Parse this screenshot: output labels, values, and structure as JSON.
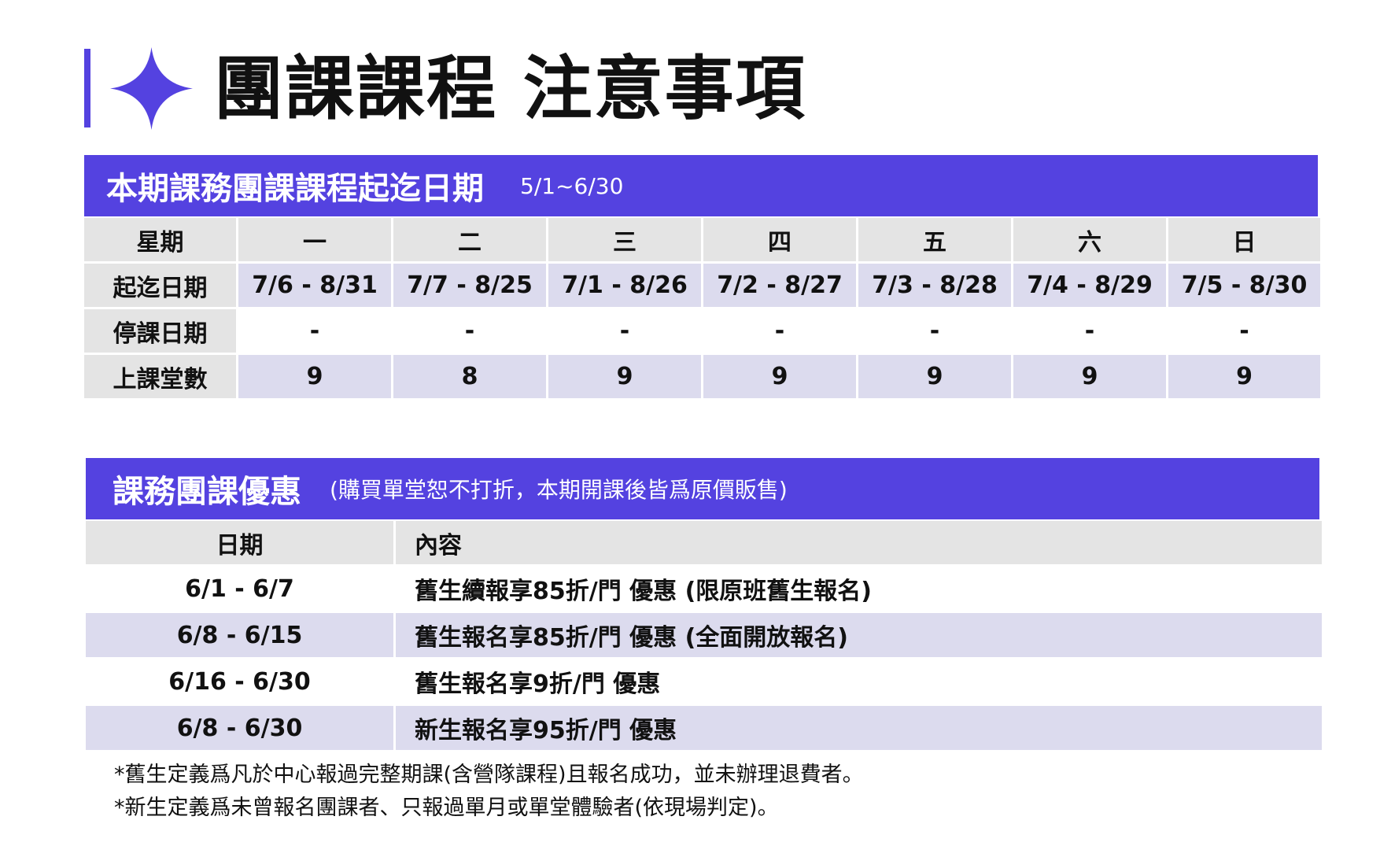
{
  "title": "團課課程 注意事項",
  "schedule": {
    "header_main": "本期課務團課課程起迄日期",
    "header_sub": "5/1~6/30",
    "row_labels": [
      "星期",
      "起迄日期",
      "停課日期",
      "上課堂數"
    ],
    "days": [
      "一",
      "二",
      "三",
      "四",
      "五",
      "六",
      "日"
    ],
    "date_ranges": [
      "7/6 - 8/31",
      "7/7 - 8/25",
      "7/1 - 8/26",
      "7/2 - 8/27",
      "7/3 - 8/28",
      "7/4 - 8/29",
      "7/5 - 8/30"
    ],
    "suspended": [
      "-",
      "-",
      "-",
      "-",
      "-",
      "-",
      "-"
    ],
    "class_counts": [
      "9",
      "8",
      "9",
      "9",
      "9",
      "9",
      "9"
    ]
  },
  "discount": {
    "header_main": "課務團課優惠",
    "header_sub": "(購買單堂恕不打折，本期開課後皆爲原價販售)",
    "columns": [
      "日期",
      "內容"
    ],
    "rows": [
      {
        "date": "6/1 - 6/7",
        "content": "舊生續報享85折/門 優惠 (限原班舊生報名)"
      },
      {
        "date": "6/8 - 6/15",
        "content": "舊生報名享85折/門 優惠 (全面開放報名)"
      },
      {
        "date": "6/16 - 6/30",
        "content": "舊生報名享9折/門 優惠"
      },
      {
        "date": "6/8 - 6/30",
        "content": "新生報名享95折/門 優惠"
      }
    ]
  },
  "notes": [
    "*舊生定義爲凡於中心報過完整期課(含營隊課程)且報名成功，並未辦理退費者。",
    "*新生定義爲未曾報名團課者、只報過單月或單堂體驗者(依現場判定)。"
  ],
  "colors": {
    "accent": "#5442e0",
    "lavender": "#dcdbee",
    "gray": "#e4e4e4"
  }
}
